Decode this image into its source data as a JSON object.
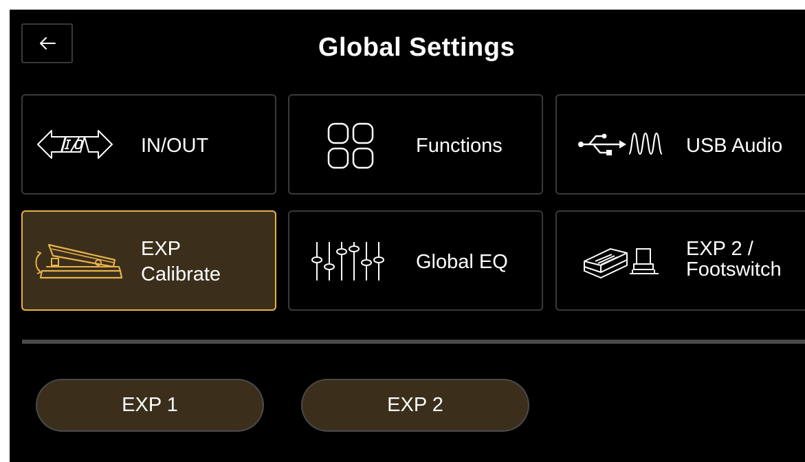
{
  "header": {
    "title": "Global Settings",
    "back_icon": "arrow-left-icon"
  },
  "tiles": [
    {
      "label": "IN/OUT",
      "icon": "in-out-icon",
      "active": false
    },
    {
      "label": "Functions",
      "icon": "grid-icon",
      "active": false
    },
    {
      "label": "USB Audio",
      "icon": "usb-audio-icon",
      "active": false
    },
    {
      "label_line1": "EXP",
      "label_line2": "Calibrate",
      "icon": "expression-pedal-icon",
      "active": true
    },
    {
      "label": "Global EQ",
      "icon": "eq-sliders-icon",
      "active": false
    },
    {
      "label_line1": "EXP 2 /",
      "label_line2": "Footswitch",
      "icon": "footswitch-icon",
      "active": false
    }
  ],
  "pedal_buttons": [
    {
      "label": "EXP 1"
    },
    {
      "label": "EXP 2"
    }
  ],
  "colors": {
    "background": "#000000",
    "tile_border": "#3a3a3a",
    "active_border": "#e8b24a",
    "active_fill": "#3b2f1c",
    "accent": "#e8b24a",
    "text": "#ffffff"
  }
}
